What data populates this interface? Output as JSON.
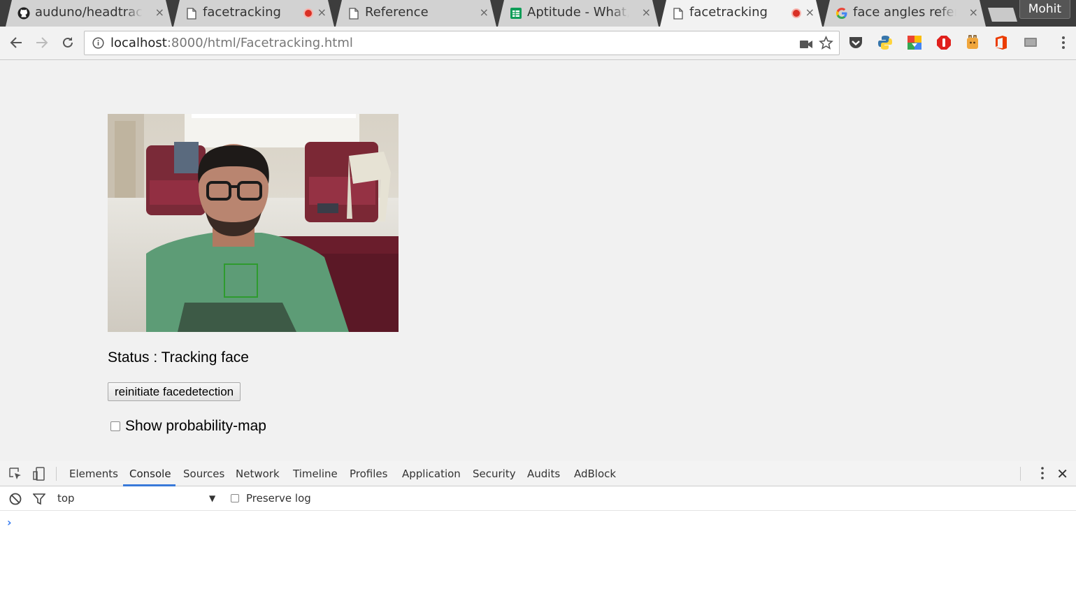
{
  "browser": {
    "tabs": [
      {
        "title": "auduno/headtrackr",
        "icon": "github-icon",
        "recording": false,
        "active": false
      },
      {
        "title": "facetracking",
        "icon": "page-icon",
        "recording": true,
        "active": false
      },
      {
        "title": "Reference",
        "icon": "page-icon",
        "recording": false,
        "active": false
      },
      {
        "title": "Aptitude - What, Why",
        "icon": "sheets-icon",
        "recording": false,
        "active": false
      },
      {
        "title": "facetracking",
        "icon": "page-icon",
        "recording": true,
        "active": true
      },
      {
        "title": "face angles reference",
        "icon": "google-icon",
        "recording": false,
        "active": false
      }
    ],
    "profile_name": "Mohit",
    "close_glyph": "×",
    "address": {
      "host": "localhost",
      "path": ":8000/html/Facetracking.html"
    },
    "extensions": [
      "pocket-icon",
      "python-icon",
      "drive-icon",
      "adblock-icon",
      "honey-icon",
      "office-icon",
      "cast-icon"
    ]
  },
  "page": {
    "status_text": "Status : Tracking face",
    "reinit_button": "reinitiate facedetection",
    "probability_label": "Show probability-map",
    "probability_checked": false,
    "tracking_box_color": "#2e9b2e"
  },
  "devtools": {
    "tabs": [
      "Elements",
      "Console",
      "Sources",
      "Network",
      "Timeline",
      "Profiles",
      "Application",
      "Security",
      "Audits",
      "AdBlock"
    ],
    "active_tab": "Console",
    "context": "top",
    "preserve_log_label": "Preserve log",
    "prompt_glyph": "›",
    "close_glyph": "✕",
    "accent": "#3879d9"
  }
}
